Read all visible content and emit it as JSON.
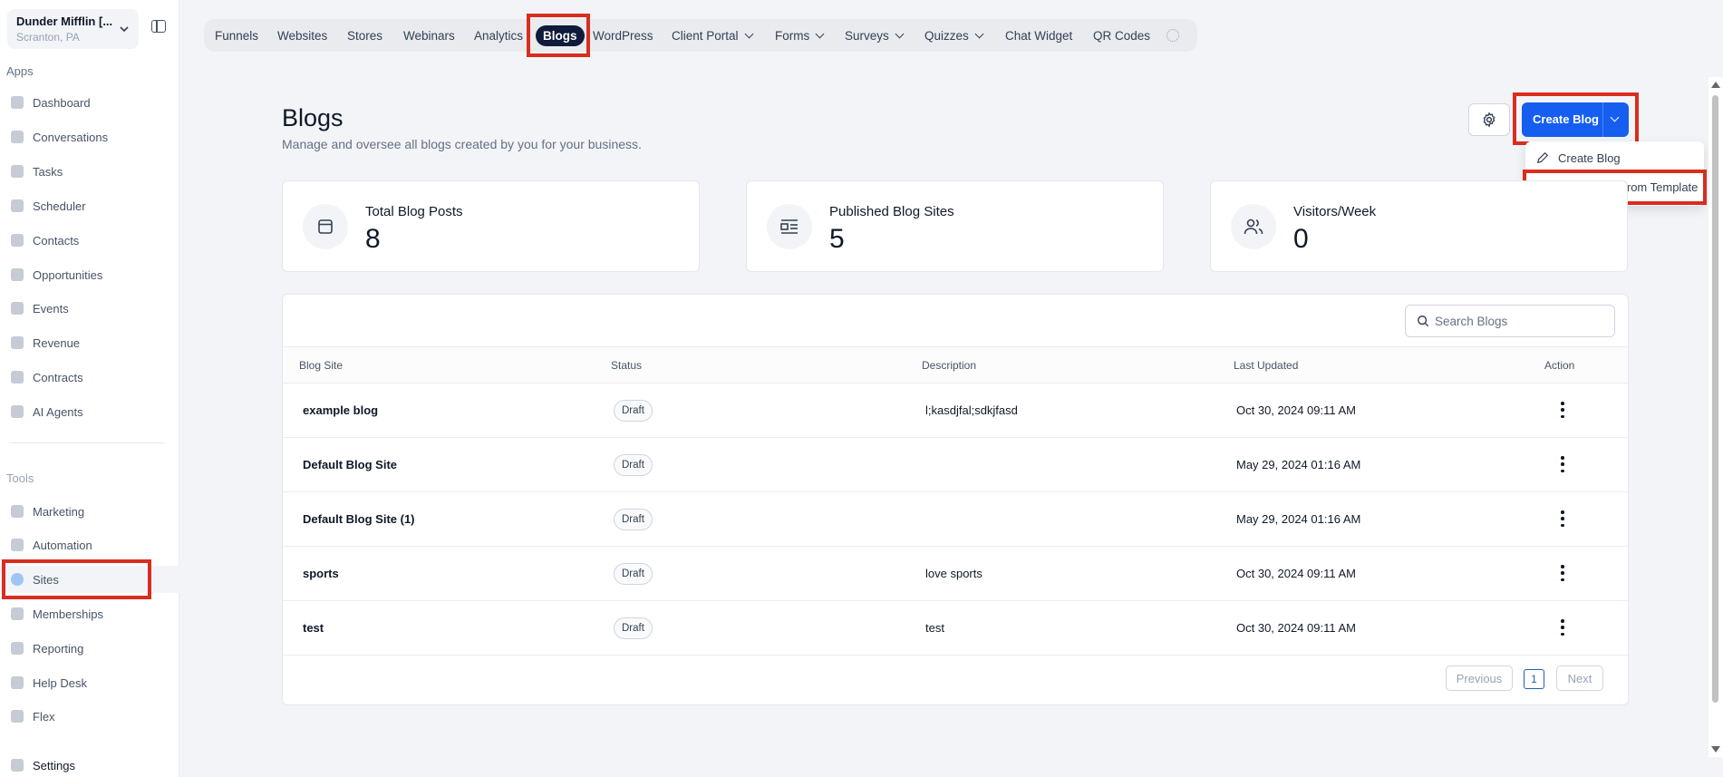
{
  "account": {
    "name": "Dunder Mifflin [...",
    "location": "Scranton, PA"
  },
  "sidebar": {
    "apps_label": "Apps",
    "tools_label": "Tools",
    "apps": [
      {
        "label": "Dashboard",
        "icon": "dashboard-icon"
      },
      {
        "label": "Conversations",
        "icon": "conversations-icon"
      },
      {
        "label": "Tasks",
        "icon": "tasks-icon"
      },
      {
        "label": "Scheduler",
        "icon": "calendar-icon"
      },
      {
        "label": "Contacts",
        "icon": "contacts-icon"
      },
      {
        "label": "Opportunities",
        "icon": "opportunities-icon"
      },
      {
        "label": "Events",
        "icon": "events-icon"
      },
      {
        "label": "Revenue",
        "icon": "revenue-icon"
      },
      {
        "label": "Contracts",
        "icon": "contracts-icon"
      },
      {
        "label": "AI Agents",
        "icon": "ai-agents-icon"
      }
    ],
    "tools": [
      {
        "label": "Marketing",
        "icon": "marketing-icon"
      },
      {
        "label": "Automation",
        "icon": "automation-icon"
      },
      {
        "label": "Sites",
        "icon": "sites-icon",
        "active": true
      },
      {
        "label": "Memberships",
        "icon": "memberships-icon"
      },
      {
        "label": "Reporting",
        "icon": "reporting-icon"
      },
      {
        "label": "Help Desk",
        "icon": "help-desk-icon"
      },
      {
        "label": "Flex",
        "icon": "flex-icon"
      }
    ],
    "settings_label": "Settings"
  },
  "tabs": [
    {
      "label": "Funnels"
    },
    {
      "label": "Websites"
    },
    {
      "label": "Stores"
    },
    {
      "label": "Webinars"
    },
    {
      "label": "Analytics"
    },
    {
      "label": "Blogs",
      "active": true
    },
    {
      "label": "WordPress"
    },
    {
      "label": "Client Portal",
      "dropdown": true
    },
    {
      "label": "Forms",
      "dropdown": true
    },
    {
      "label": "Surveys",
      "dropdown": true
    },
    {
      "label": "Quizzes",
      "dropdown": true
    },
    {
      "label": "Chat Widget"
    },
    {
      "label": "QR Codes"
    }
  ],
  "page": {
    "title": "Blogs",
    "subtitle": "Manage and oversee all blogs created by you for your business.",
    "create_button": "Create Blog",
    "dropdown": [
      "Create Blog",
      "Create Blog from Template"
    ]
  },
  "stats": [
    {
      "label": "Total Blog Posts",
      "value": "8",
      "icon": "blog-post-icon"
    },
    {
      "label": "Published Blog Sites",
      "value": "5",
      "icon": "published-sites-icon"
    },
    {
      "label": "Visitors/Week",
      "value": "0",
      "icon": "visitors-icon"
    }
  ],
  "search": {
    "placeholder": "Search Blogs"
  },
  "table": {
    "columns": [
      "Blog Site",
      "Status",
      "Description",
      "Last Updated",
      "Action"
    ],
    "rows": [
      {
        "site": "example blog",
        "status": "Draft",
        "description": "l;kasdjfal;sdkjfasd",
        "updated": "Oct 30, 2024 09:11 AM"
      },
      {
        "site": "Default Blog Site",
        "status": "Draft",
        "description": "",
        "updated": "May 29, 2024 01:16 AM"
      },
      {
        "site": "Default Blog Site (1)",
        "status": "Draft",
        "description": "",
        "updated": "May 29, 2024 01:16 AM"
      },
      {
        "site": "sports",
        "status": "Draft",
        "description": "love sports",
        "updated": "Oct 30, 2024 09:11 AM"
      },
      {
        "site": "test",
        "status": "Draft",
        "description": "test",
        "updated": "Oct 30, 2024 09:11 AM"
      }
    ]
  },
  "pagination": {
    "previous": "Previous",
    "page": "1",
    "next": "Next"
  },
  "colors": {
    "primary": "#155eef",
    "active_tab": "#101a3b",
    "highlight": "#d92d20"
  }
}
